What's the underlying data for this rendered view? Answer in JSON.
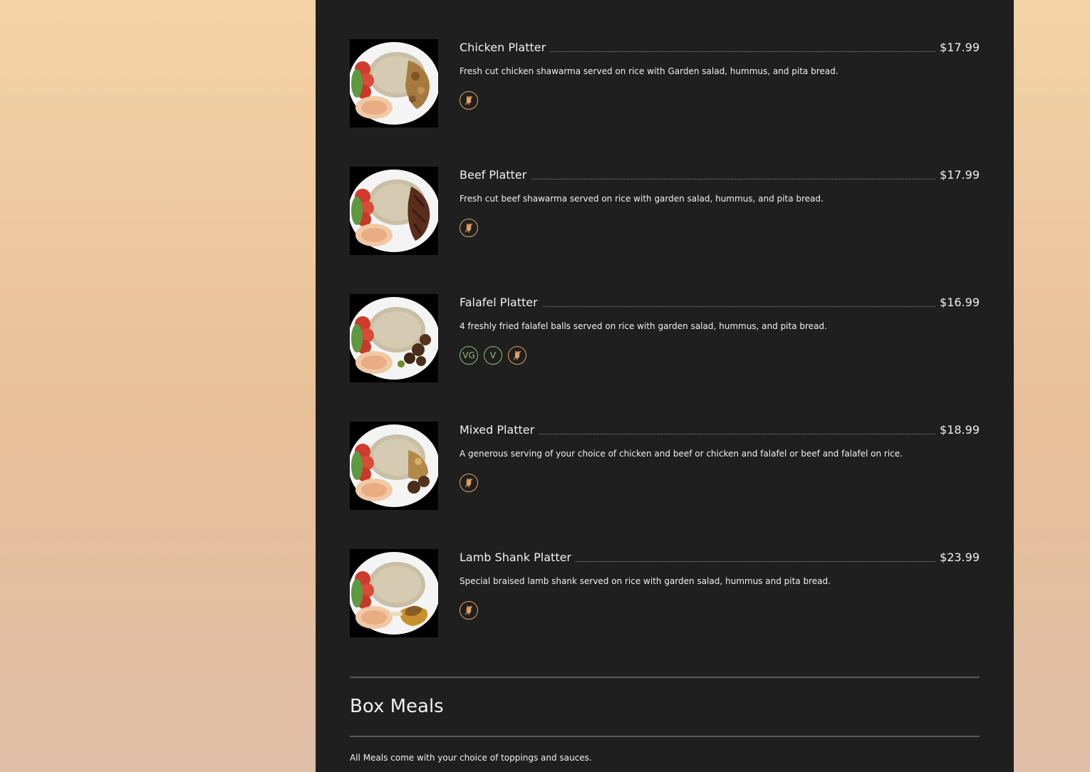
{
  "menu_items": [
    {
      "name": "Chicken Platter",
      "price": "$17.99",
      "description": "Fresh cut chicken shawarma served on rice with Garden salad, hummus, and pita bread.",
      "badges": [
        "gluten-free-icon"
      ],
      "protein": "chicken"
    },
    {
      "name": "Beef Platter",
      "price": "$17.99",
      "description": "Fresh cut beef shawarma served on rice with garden salad, hummus, and pita bread.",
      "badges": [
        "gluten-free-icon"
      ],
      "protein": "beef"
    },
    {
      "name": "Falafel Platter",
      "price": "$16.99",
      "description": "4 freshly fried falafel balls served on rice with garden salad, hummus, and pita bread.",
      "badges": [
        "vegan-icon",
        "vegetarian-icon",
        "gluten-free-icon"
      ],
      "protein": "falafel"
    },
    {
      "name": "Mixed Platter",
      "price": "$18.99",
      "description": "A generous serving of your choice of  chicken and beef or chicken and falafel or beef and falafel on rice.",
      "badges": [
        "gluten-free-icon"
      ],
      "protein": "mixed"
    },
    {
      "name": "Lamb Shank Platter",
      "price": "$23.99",
      "description": "Special braised lamb shank served on rice with garden salad, hummus and pita bread.",
      "badges": [
        "gluten-free-icon"
      ],
      "protein": "lamb"
    }
  ],
  "badge_labels": {
    "vegan": "VG",
    "vegetarian": "V"
  },
  "section": {
    "title": "Box Meals",
    "note": "All Meals come with your choice of toppings and sauces."
  },
  "colors": {
    "panel": "#1f1f1f",
    "text": "#f0f0f0",
    "gluten_free": "#e9a35a",
    "vegan": "#8fbf6d"
  }
}
